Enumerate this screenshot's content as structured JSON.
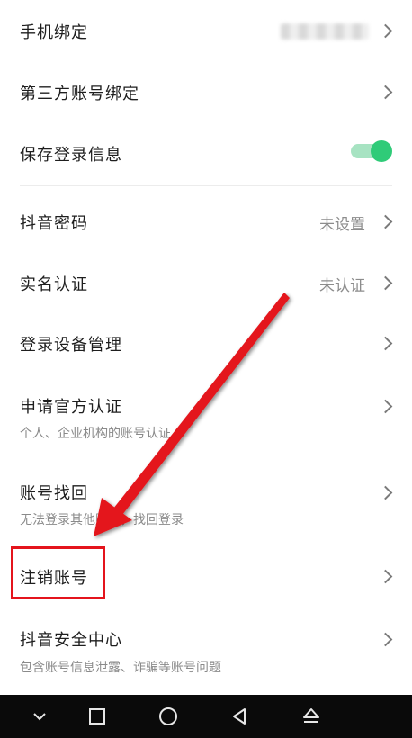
{
  "settings": {
    "phone_binding": {
      "label": "手机绑定"
    },
    "third_party_binding": {
      "label": "第三方账号绑定"
    },
    "save_login_info": {
      "label": "保存登录信息",
      "enabled": true
    },
    "password": {
      "label": "抖音密码",
      "value": "未设置"
    },
    "real_name": {
      "label": "实名认证",
      "value": "未认证"
    },
    "device_management": {
      "label": "登录设备管理"
    },
    "official_verification": {
      "label": "申请官方认证",
      "subtitle": "个人、企业机构的账号认证"
    },
    "account_recovery": {
      "label": "账号找回",
      "subtitle": "无法登录其他账号，找回登录"
    },
    "cancel_account": {
      "label": "注销账号"
    },
    "security_center": {
      "label": "抖音安全中心",
      "subtitle": "包含账号信息泄露、诈骗等账号问题"
    }
  },
  "colors": {
    "toggle_on": "#2fcb78",
    "annotation": "#e4141c"
  },
  "navbar": {
    "icons": [
      "chevron-down-icon",
      "square-icon",
      "circle-home-icon",
      "triangle-back-icon",
      "eject-icon"
    ]
  }
}
